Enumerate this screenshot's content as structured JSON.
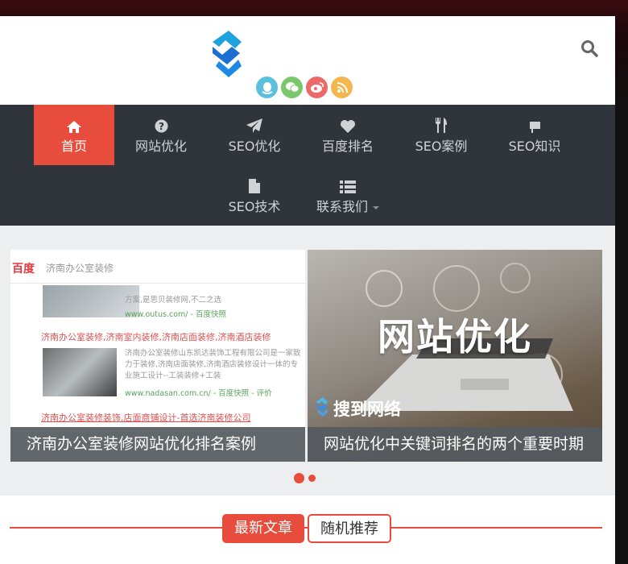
{
  "header": {
    "logo_icon": "brand-logo-icon",
    "social_links": [
      {
        "icon": "qq-icon",
        "color": "#5bc0de"
      },
      {
        "icon": "wechat-icon",
        "color": "#7bc86c"
      },
      {
        "icon": "weibo-icon",
        "color": "#ec6a6a"
      },
      {
        "icon": "rss-icon",
        "color": "#f5b54f"
      }
    ],
    "search_icon": "search-icon"
  },
  "nav": {
    "items": [
      {
        "label": "首页",
        "icon": "home-icon",
        "active": true
      },
      {
        "label": "网站优化",
        "icon": "question-circle-icon"
      },
      {
        "label": "SEO优化",
        "icon": "paper-plane-icon"
      },
      {
        "label": "百度排名",
        "icon": "heart-icon"
      },
      {
        "label": "SEO案例",
        "icon": "cutlery-icon"
      },
      {
        "label": "SEO知识",
        "icon": "flag-icon"
      },
      {
        "label": "SEO技术",
        "icon": "file-icon"
      },
      {
        "label": "联系我们",
        "icon": "list-icon",
        "has_dropdown": true
      }
    ]
  },
  "slider": {
    "slides": [
      {
        "caption": "济南办公室装修网站优化排名案例",
        "screenshot": {
          "brand": "百度",
          "query": "济南办公室装修",
          "results": [
            {
              "title": "",
              "desc": "方案,是思贝装修网,不二之选",
              "url": "www.outus.com/ - 百度快照"
            },
            {
              "title": "济南办公室装修,济南室内装修,济南店面装修,济南酒店装修",
              "desc": "济南办公室装修山东凯达装饰工程有限公司是一家致力于装修,济南店面装修,济南酒店装修设计一体的专业施工设计--工装装修+工装",
              "url": "www.nadasan.com.cn/ - 百度快照 - 评价"
            },
            {
              "title": "济南办公室装修装饰,店面商铺设计-首选济南装修公司",
              "desc": "",
              "url": ""
            }
          ]
        }
      },
      {
        "caption": "网站优化中关键词排名的两个重要时期",
        "overlay_title": "网站优化",
        "watermark": "搜到网络"
      }
    ]
  },
  "section": {
    "tabs": [
      {
        "label": "最新文章",
        "active": true
      },
      {
        "label": "随机推荐",
        "active": false
      }
    ]
  },
  "colors": {
    "accent": "#e74c3c",
    "nav_bg": "#2f353a"
  }
}
